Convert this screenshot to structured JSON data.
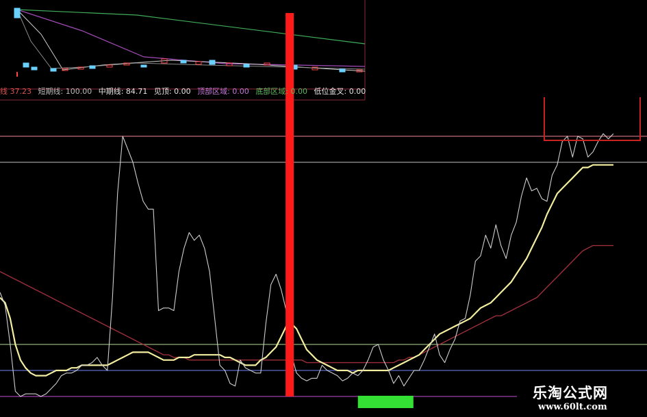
{
  "legend": [
    {
      "text": "线 37.23",
      "color": "#d9534f"
    },
    {
      "text": "短期线: 100.00",
      "color": "#bdbdbd"
    },
    {
      "text": "中期线: 84.71",
      "color": "#e6e6e6"
    },
    {
      "text": "见顶: 0.00",
      "color": "#e6e6e6"
    },
    {
      "text": "顶部区域: 0.00",
      "color": "#c678dd"
    },
    {
      "text": "底部区域: 0.00",
      "color": "#5cb85c"
    },
    {
      "text": "低位金叉: 0.00",
      "color": "#e6e6e6"
    }
  ],
  "watermark": {
    "title": "乐淘公式网",
    "url": "www.60lt.com"
  },
  "colors": {
    "short_line": "#cfcfcf",
    "mid_line": "#f3eea0",
    "long_line": "#9e2f3a",
    "top_box": "#cc2222",
    "signal_bar": "#ff1a1a",
    "bottom_bar": "#33e033",
    "level_top": "#c66a7a",
    "level_upper": "#9c9c9c",
    "level_mid": "#8fae7a",
    "level_low": "#5b6bc8",
    "level_bottom": "#a03fb0"
  },
  "chart_data": {
    "type": "line",
    "ylim": [
      0,
      100
    ],
    "x": [
      0,
      1,
      2,
      3,
      4,
      5,
      6,
      7,
      8,
      9,
      10,
      11,
      12,
      13,
      14,
      15,
      16,
      17,
      18,
      19,
      20,
      21,
      22,
      23,
      24,
      25,
      26,
      27,
      28,
      29,
      30,
      31,
      32,
      33,
      34,
      35,
      36,
      37,
      38,
      39,
      40,
      41,
      42,
      43,
      44,
      45,
      46,
      47,
      48,
      49,
      50,
      51,
      52,
      53,
      54,
      55,
      56,
      57,
      58,
      59,
      60,
      61,
      62,
      63,
      64,
      65,
      66,
      67,
      68,
      69,
      70,
      71,
      72,
      73,
      74,
      75,
      76,
      77,
      78,
      79,
      80,
      81,
      82,
      83,
      84,
      85,
      86,
      87,
      88,
      89,
      90,
      91,
      92,
      93,
      94,
      95,
      96,
      97,
      98,
      99,
      100,
      101,
      102,
      103,
      104,
      105,
      106,
      107,
      108,
      109,
      110,
      111,
      112,
      113,
      114,
      115,
      116,
      117,
      118,
      119,
      120
    ],
    "reference_levels": [
      100,
      90,
      20,
      10,
      0
    ],
    "series": [
      {
        "name": "短期线",
        "role": "short",
        "values": [
          40,
          35,
          20,
          2,
          0,
          1,
          1,
          1,
          0,
          1,
          3,
          5,
          8,
          9,
          9,
          10,
          12,
          12,
          13,
          15,
          12,
          10,
          38,
          78,
          100,
          95,
          90,
          82,
          75,
          72,
          72,
          33,
          34,
          34,
          33,
          48,
          57,
          63,
          60,
          62,
          57,
          48,
          30,
          12,
          10,
          5,
          4,
          14,
          11,
          10,
          9,
          9,
          28,
          43,
          47,
          41,
          33,
          16,
          9,
          7,
          6,
          7,
          7,
          12,
          10,
          9,
          8,
          6,
          7,
          9,
          8,
          10,
          14,
          19,
          20,
          14,
          10,
          5,
          8,
          4,
          7,
          10,
          10,
          14,
          19,
          24,
          16,
          13,
          18,
          22,
          29,
          30,
          39,
          52,
          54,
          62,
          57,
          66,
          58,
          53,
          62,
          67,
          77,
          84,
          79,
          80,
          76,
          75,
          85,
          89,
          98,
          100,
          92,
          100,
          99,
          92,
          94,
          98,
          102,
          99,
          101
        ]
      },
      {
        "name": "中期线",
        "role": "mid",
        "values": [
          38,
          36,
          30,
          20,
          14,
          11,
          9,
          8,
          8,
          8,
          9,
          10,
          10,
          10,
          11,
          11,
          12,
          12,
          12,
          12,
          12,
          12,
          13,
          14,
          15,
          16,
          17,
          17,
          17,
          17,
          16,
          15,
          14,
          14,
          14,
          15,
          15,
          15,
          16,
          16,
          16,
          16,
          16,
          16,
          15,
          15,
          14,
          13,
          12,
          12,
          12,
          14,
          15,
          17,
          19,
          23,
          27,
          28,
          26,
          22,
          18,
          16,
          14,
          13,
          12,
          11,
          10,
          10,
          10,
          9,
          10,
          10,
          10,
          10,
          10,
          10,
          10,
          11,
          12,
          13,
          14,
          15,
          16,
          18,
          20,
          22,
          24,
          25,
          26,
          27,
          28,
          29,
          30,
          32,
          34,
          35,
          36,
          38,
          40,
          42,
          44,
          47,
          50,
          53,
          57,
          61,
          65,
          70,
          74,
          78,
          80,
          82,
          84,
          86,
          88,
          88,
          89,
          89,
          89,
          89,
          89
        ]
      },
      {
        "name": "长期线",
        "role": "long",
        "values": [
          48,
          47,
          46,
          45,
          44,
          43,
          42,
          41,
          40,
          39,
          38,
          37,
          36,
          35,
          34,
          33,
          32,
          31,
          30,
          29,
          28,
          27,
          26,
          25,
          24,
          23,
          22,
          21,
          20,
          19,
          18,
          17,
          16,
          16,
          15,
          15,
          15,
          14,
          14,
          14,
          14,
          14,
          14,
          14,
          14,
          14,
          14,
          14,
          14,
          14,
          14,
          14,
          14,
          14,
          14,
          14,
          14,
          14,
          14,
          14,
          13,
          13,
          13,
          13,
          13,
          13,
          13,
          13,
          13,
          13,
          13,
          13,
          13,
          13,
          13,
          13,
          13,
          13,
          14,
          14,
          15,
          15,
          16,
          17,
          18,
          19,
          20,
          21,
          22,
          23,
          24,
          25,
          26,
          27,
          28,
          29,
          30,
          31,
          31,
          32,
          33,
          34,
          35,
          36,
          37,
          38,
          40,
          42,
          44,
          46,
          48,
          50,
          52,
          54,
          56,
          57,
          58,
          58,
          58,
          58,
          58
        ]
      }
    ],
    "signals": [
      {
        "name": "低位金叉",
        "x": 56,
        "value": 100
      },
      {
        "name": "底部区域",
        "x_range": [
          68,
          81
        ]
      },
      {
        "name": "顶部区域",
        "x_range": [
          107,
          120
        ]
      }
    ]
  }
}
